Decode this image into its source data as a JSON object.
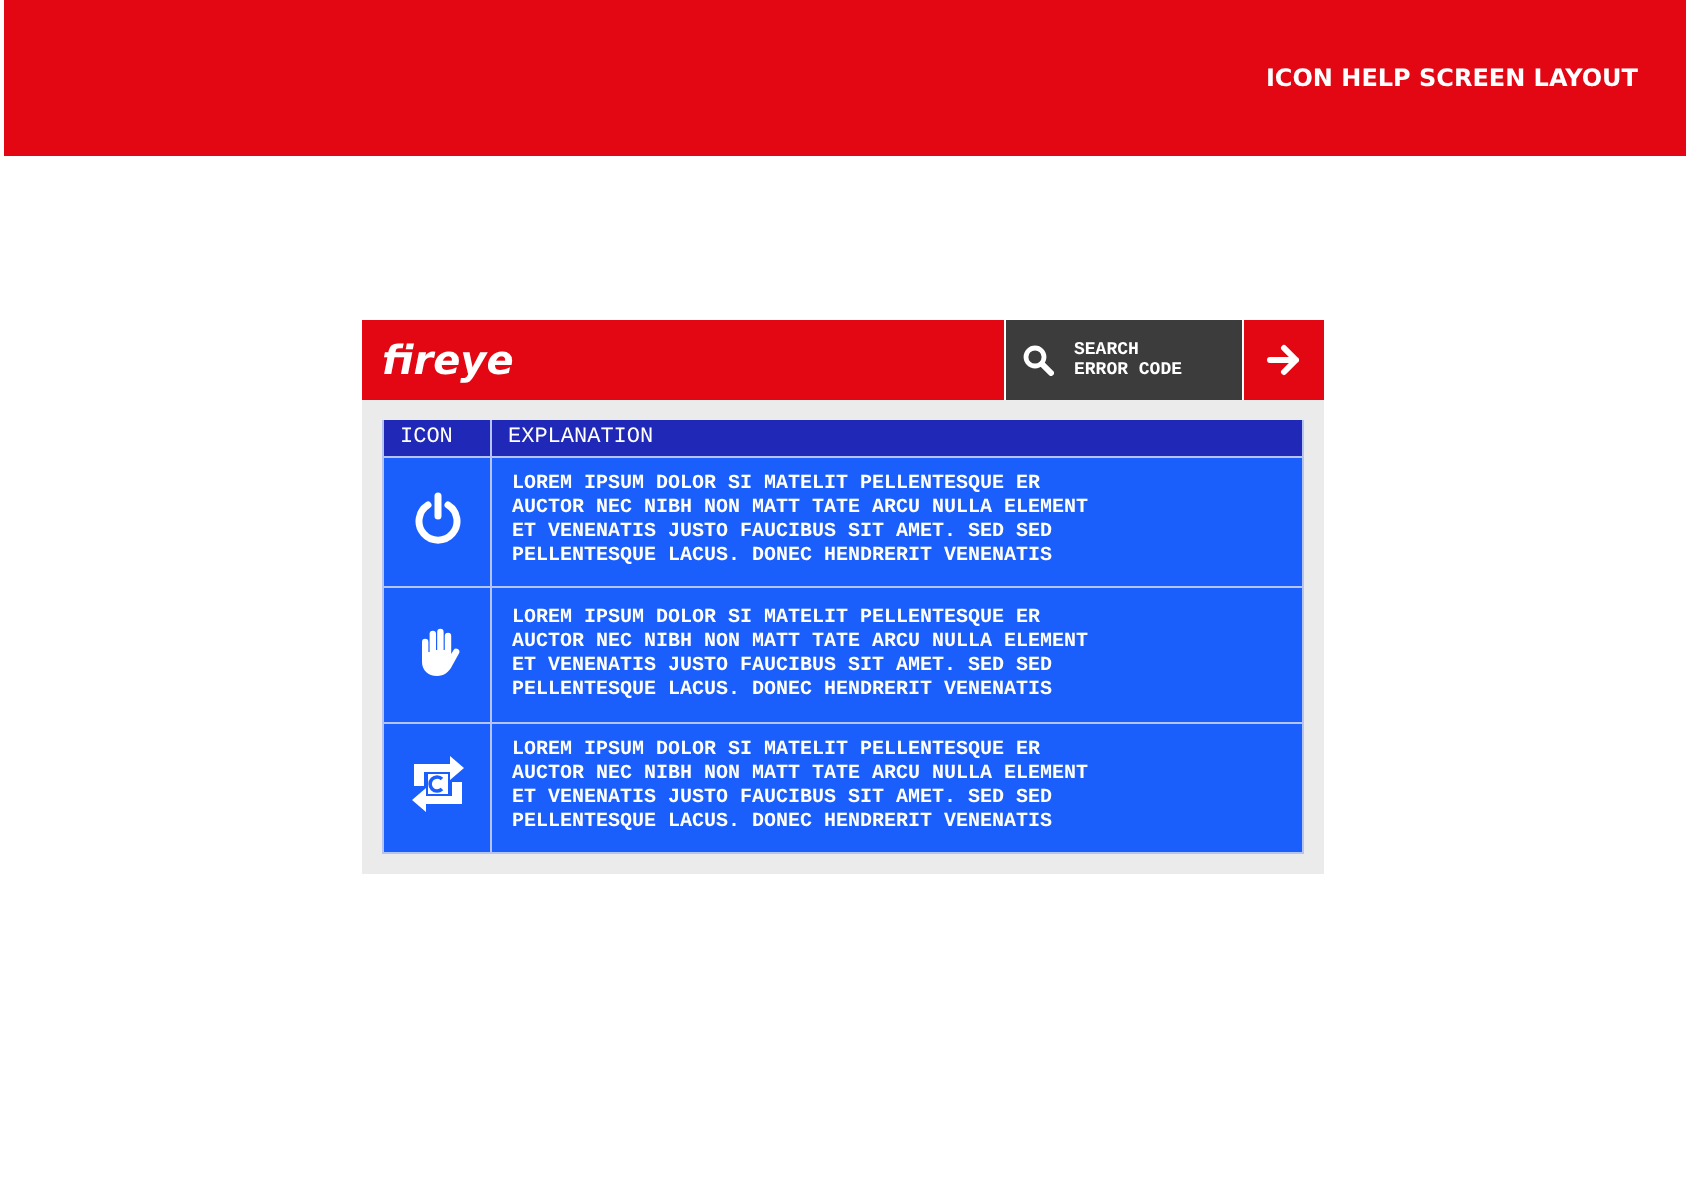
{
  "banner": {
    "title": "ICON HELP SCREEN LAYOUT"
  },
  "panel": {
    "logo": "fireye",
    "search_button": "SEARCH ERROR CODE",
    "table": {
      "columns": [
        "ICON",
        "EXPLANATION"
      ],
      "rows": [
        {
          "kind": "power",
          "explanation": "LOREM IPSUM DOLOR SI MATELIT PELLENTESQUE ER AUCTOR NEC NIBH NON MATT TATE ARCU NULLA ELEMENT ET VENENATIS JUSTO FAUCIBUS SIT AMET. SED SED PELLENTESQUE LACUS. DONEC HENDRERIT VENENATIS"
        },
        {
          "kind": "hand",
          "explanation": "LOREM IPSUM DOLOR SI MATELIT PELLENTESQUE ER AUCTOR NEC NIBH NON MATT TATE ARCU NULLA ELEMENT ET VENENATIS JUSTO FAUCIBUS SIT AMET. SED SED PELLENTESQUE LACUS. DONEC HENDRERIT VENENATIS"
        },
        {
          "kind": "reset",
          "explanation": "LOREM IPSUM DOLOR SI MATELIT PELLENTESQUE ER AUCTOR NEC NIBH NON MATT TATE ARCU NULLA ELEMENT ET VENENATIS JUSTO FAUCIBUS SIT AMET. SED SED PELLENTESQUE LACUS. DONEC HENDRERIT VENENATIS"
        }
      ]
    }
  }
}
